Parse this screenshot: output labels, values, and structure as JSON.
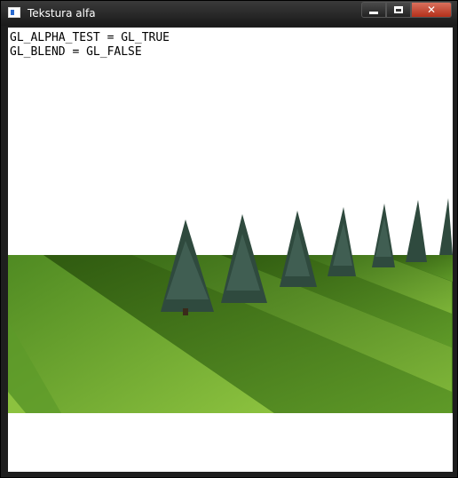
{
  "window": {
    "title": "Tekstura alfa",
    "controls": {
      "minimize_icon": "minimize-icon",
      "maximize_icon": "maximize-icon",
      "close_icon": "close-icon",
      "close_glyph": "✕"
    }
  },
  "overlay": {
    "line1": "GL_ALPHA_TEST = GL_TRUE",
    "line2": "GL_BLEND = GL_FALSE"
  },
  "scene": {
    "sky_color": "#ffffff",
    "grass_light": "#6fa832",
    "grass_dark": "#2f5a10",
    "tree_color": "#2f4a3e",
    "tree_count": 7
  }
}
